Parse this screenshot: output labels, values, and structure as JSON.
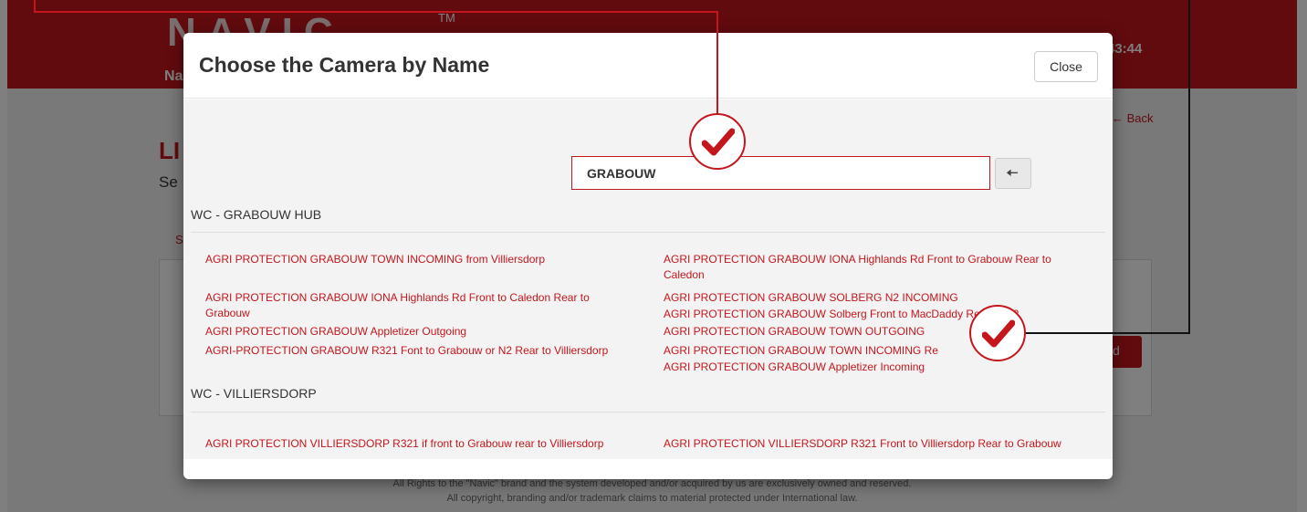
{
  "background_page": {
    "logo": "NAVIC",
    "trademark": "TM",
    "nav_label": "Na",
    "clock": ":43:44",
    "back_label": "Back",
    "title_partial": "LI",
    "subtitle_partial": "Se",
    "tab_partial": "S",
    "button_partial": "d",
    "footer_line1": "All Rights to the \"Navic\" brand and the system developed and/or acquired by us are exclusively owned and reserved.",
    "footer_line2": "All copyright, branding and/or trademark claims to material protected under International law."
  },
  "modal": {
    "title": "Choose the Camera by Name",
    "close_label": "Close",
    "search": {
      "value": "GRABOUW",
      "placeholder": ""
    },
    "search_button_icon": "arrow-left-icon",
    "groups": [
      {
        "name": "WC - GRABOUW HUB",
        "cameras_left": [
          "AGRI PROTECTION GRABOUW TOWN INCOMING from Villiersdorp",
          "AGRI PROTECTION GRABOUW IONA Highlands Rd Front to Caledon Rear to Grabouw",
          "AGRI PROTECTION GRABOUW Appletizer Outgoing",
          "AGRI-PROTECTION GRABOUW R321 Font to Grabouw or N2 Rear to Villiersdorp"
        ],
        "cameras_right": [
          "AGRI PROTECTION GRABOUW IONA Highlands Rd Front to Grabouw Rear to Caledon",
          "AGRI PROTECTION GRABOUW SOLBERG N2 INCOMING",
          "AGRI PROTECTION GRABOUW Solberg Front to MacDaddy Rear to N2",
          "AGRI PROTECTION GRABOUW TOWN OUTGOING",
          "AGRI PROTECTION GRABOUW TOWN INCOMING Re",
          "AGRI PROTECTION GRABOUW Appletizer Incoming"
        ]
      },
      {
        "name": "WC - VILLIERSDORP",
        "cameras_left": [
          "AGRI PROTECTION VILLIERSDORP R321 if front to Grabouw rear to Villiersdorp"
        ],
        "cameras_right": [
          "AGRI PROTECTION VILLIERSDORP R321 Front to Villiersdorp Rear to Grabouw"
        ]
      }
    ]
  },
  "annotations": {
    "icons": [
      "checkmark-icon",
      "checkmark-icon"
    ],
    "colors": {
      "accent": "#c4161c",
      "connector_black": "#111111"
    }
  }
}
